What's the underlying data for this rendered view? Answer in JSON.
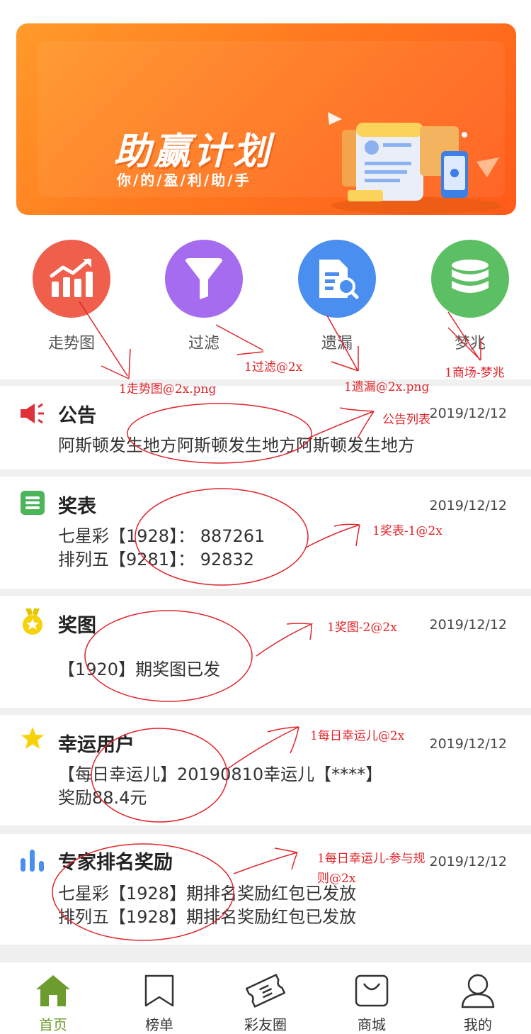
{
  "banner": {
    "title": "助赢计划",
    "subtitle": "你/的/盈/利/助/手",
    "dots": [
      false,
      true,
      false,
      false
    ]
  },
  "quick_menu": [
    {
      "label": "走势图",
      "icon": "trend-chart-icon",
      "color": "#f05e4c"
    },
    {
      "label": "过滤",
      "icon": "funnel-icon",
      "color": "#a66cf0"
    },
    {
      "label": "遗漏",
      "icon": "document-search-icon",
      "color": "#4a8ef0"
    },
    {
      "label": "梦兆",
      "icon": "database-icon",
      "color": "#5cbf63"
    }
  ],
  "cards": [
    {
      "title": "公告",
      "icon": "megaphone-icon",
      "date": "2019/12/12",
      "lines": [
        "阿斯顿发生地方阿斯顿发生地方阿斯顿发生地方"
      ]
    },
    {
      "title": "奖表",
      "icon": "list-icon",
      "date": "2019/12/12",
      "lines": [
        "七星彩【1928】： 887261",
        "排列五【9281】： 92832"
      ]
    },
    {
      "title": "奖图",
      "icon": "medal-icon",
      "date": "2019/12/12",
      "lines": [
        "【1920】期奖图已发"
      ]
    },
    {
      "title": "幸运用户",
      "icon": "star-icon",
      "date": "2019/12/12",
      "lines": [
        "【每日幸运儿】20190810幸运儿【****】",
        " 奖励88.4元"
      ]
    },
    {
      "title": "专家排名奖励",
      "icon": "bar-chart-icon",
      "date": "2019/12/12",
      "lines": [
        "七星彩【1928】期排名奖励红包已发放",
        "排列五【1928】期排名奖励红包已发放"
      ]
    }
  ],
  "tabbar": [
    {
      "label": "首页",
      "icon": "home-icon",
      "active": true
    },
    {
      "label": "榜单",
      "icon": "ranking-icon",
      "active": false
    },
    {
      "label": "彩友圈",
      "icon": "ticket-icon",
      "active": false
    },
    {
      "label": "商城",
      "icon": "shopping-bag-icon",
      "active": false
    },
    {
      "label": "我的",
      "icon": "user-icon",
      "active": false
    }
  ],
  "annotations": [
    "1走势图@2x.png",
    "1过滤@2x",
    "1遗漏@2x.png",
    "1商场-梦兆",
    "公告列表",
    "1奖表-1@2x",
    "1奖图-2@2x",
    "1每日幸运儿@2x",
    "1每日幸运儿-参与规",
    "则@2x"
  ],
  "colors": {
    "annotation": "#e0252b",
    "active_tab": "#6d9c2e",
    "banner": "#ff7a1f"
  }
}
